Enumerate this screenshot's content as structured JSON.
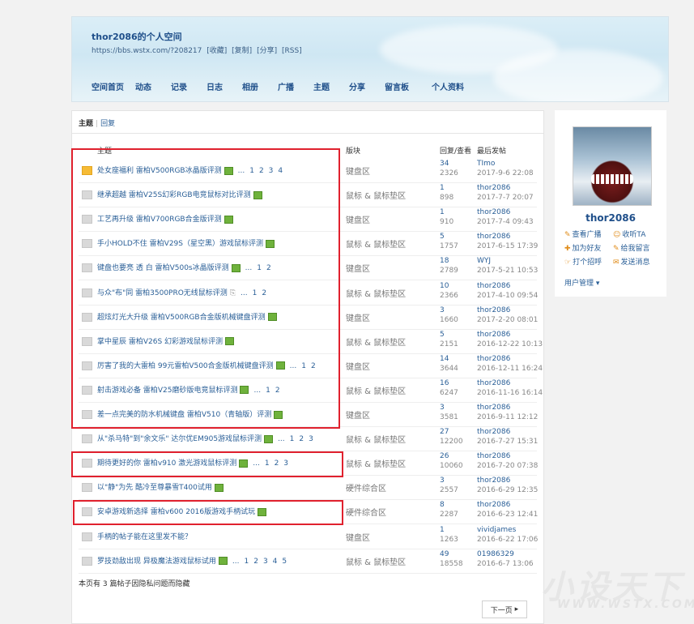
{
  "space": {
    "title": "thor2086的个人空间",
    "url": "https://bbs.wstx.com/?208217",
    "links": [
      "[收藏]",
      "[复制]",
      "[分享]",
      "[RSS]"
    ],
    "nav": [
      "空间首页",
      "动态",
      "记录",
      "日志",
      "相册",
      "广播",
      "主题",
      "分享",
      "留言板",
      "个人资料"
    ]
  },
  "tabs": {
    "active": "主题",
    "other": "回复"
  },
  "columns": {
    "topic": "主题",
    "forum": "版块",
    "stats": "回复/查看",
    "last": "最后发帖"
  },
  "threads": [
    {
      "title": "处女座福利 雷柏V500RGB冰晶版评测",
      "img": true,
      "pages": [
        "...",
        "1",
        "2",
        "3",
        "4"
      ],
      "forum": "键盘区",
      "replies": "34",
      "views": "2326",
      "author": "TImo",
      "date": "2017-9-6 22:08",
      "hot": true
    },
    {
      "title": "继承超越 雷柏V25S幻彩RGB电竞鼠标对比评测",
      "img": true,
      "pages": [],
      "forum": "鼠标 & 鼠标垫区",
      "replies": "1",
      "views": "898",
      "author": "thor2086",
      "date": "2017-7-7 20:07"
    },
    {
      "title": "工艺再升级 雷柏V700RGB合金版评测",
      "img": true,
      "pages": [],
      "forum": "键盘区",
      "replies": "1",
      "views": "910",
      "author": "thor2086",
      "date": "2017-7-4 09:43"
    },
    {
      "title": "手小HOLD不住 雷柏V29S（星空黑）游戏鼠标评测",
      "img": true,
      "pages": [],
      "forum": "鼠标 & 鼠标垫区",
      "replies": "5",
      "views": "1757",
      "author": "thor2086",
      "date": "2017-6-15 17:39"
    },
    {
      "title": "键盘也要亮 透 白 雷柏V500s冰晶版评测",
      "img": true,
      "pages": [
        "...",
        "1",
        "2"
      ],
      "forum": "键盘区",
      "replies": "18",
      "views": "2789",
      "author": "WYJ",
      "date": "2017-5-21 10:53"
    },
    {
      "title": "与众\"布\"同 雷柏3500PRO无线鼠标评测",
      "img": false,
      "clip": true,
      "pages": [
        "...",
        "1",
        "2"
      ],
      "forum": "鼠标 & 鼠标垫区",
      "replies": "10",
      "views": "2366",
      "author": "thor2086",
      "date": "2017-4-10 09:54"
    },
    {
      "title": "超炫灯光大升级 雷柏V500RGB合金版机械键盘评测",
      "img": true,
      "pages": [],
      "forum": "键盘区",
      "replies": "3",
      "views": "1660",
      "author": "thor2086",
      "date": "2017-2-20 08:01"
    },
    {
      "title": "掌中星辰 雷柏V26S 幻彩游戏鼠标评测",
      "img": true,
      "pages": [],
      "forum": "鼠标 & 鼠标垫区",
      "replies": "5",
      "views": "2151",
      "author": "thor2086",
      "date": "2016-12-22 10:13"
    },
    {
      "title": "厉害了我的大雷柏 99元雷柏V500合金版机械键盘评测",
      "img": true,
      "pages": [
        "...",
        "1",
        "2"
      ],
      "forum": "键盘区",
      "replies": "14",
      "views": "3644",
      "author": "thor2086",
      "date": "2016-12-11 16:24"
    },
    {
      "title": "射击游戏必备 雷柏V25磨砂版电竞鼠标评测",
      "img": true,
      "pages": [
        "...",
        "1",
        "2"
      ],
      "forum": "鼠标 & 鼠标垫区",
      "replies": "16",
      "views": "6247",
      "author": "thor2086",
      "date": "2016-11-16 16:14"
    },
    {
      "title": "差一点完美的防水机械键盘 雷柏V510（青轴版）评测",
      "img": true,
      "pages": [],
      "forum": "键盘区",
      "replies": "3",
      "views": "3581",
      "author": "thor2086",
      "date": "2016-9-11 12:12"
    },
    {
      "title": "从\"杀马特\"到\"余文乐\" 达尔优EM905游戏鼠标评测",
      "img": true,
      "pages": [
        "...",
        "1",
        "2",
        "3"
      ],
      "forum": "鼠标 & 鼠标垫区",
      "replies": "27",
      "views": "12200",
      "author": "thor2086",
      "date": "2016-7-27 15:31"
    },
    {
      "title": "期待更好的你 雷柏v910 激光游戏鼠标评测",
      "img": true,
      "pages": [
        "...",
        "1",
        "2",
        "3"
      ],
      "forum": "鼠标 & 鼠标垫区",
      "replies": "26",
      "views": "10060",
      "author": "thor2086",
      "date": "2016-7-20 07:38"
    },
    {
      "title": "以\"静\"为先 酷冷至尊暴雪T400试用",
      "img": true,
      "pages": [],
      "forum": "硬件综合区",
      "replies": "3",
      "views": "2557",
      "author": "thor2086",
      "date": "2016-6-29 12:35"
    },
    {
      "title": "安卓游戏新选择 雷柏v600 2016版游戏手柄试玩",
      "img": true,
      "pages": [],
      "forum": "硬件综合区",
      "replies": "8",
      "views": "2287",
      "author": "thor2086",
      "date": "2016-6-23 12:41"
    },
    {
      "title": "手柄的帖子能在这里发不能？",
      "img": false,
      "pages": [],
      "forum": "键盘区",
      "replies": "1",
      "views": "1263",
      "author": "vividjames",
      "date": "2016-6-22 17:06"
    },
    {
      "title": "罗技劲敌出现 异极魔法游戏鼠标试用",
      "img": true,
      "pages": [
        "...",
        "1",
        "2",
        "3",
        "4",
        "5"
      ],
      "forum": "鼠标 & 鼠标垫区",
      "replies": "49",
      "views": "18558",
      "author": "01986329",
      "date": "2016-6-7 13:06"
    }
  ],
  "hidden_note": "本页有 3 篇帖子因隐私问题而隐藏",
  "next_label": "下一页",
  "profile": {
    "name": "thor2086",
    "actions": [
      "查看广播",
      "收听TA",
      "加为好友",
      "给我留言",
      "打个招呼",
      "发送消息"
    ],
    "manage": "用户管理"
  },
  "watermark": {
    "big": "小设天下",
    "small": "WWW.WSTX.COM"
  },
  "colors": {
    "link": "#2a5f97",
    "highlight_box": "#e0212e"
  }
}
